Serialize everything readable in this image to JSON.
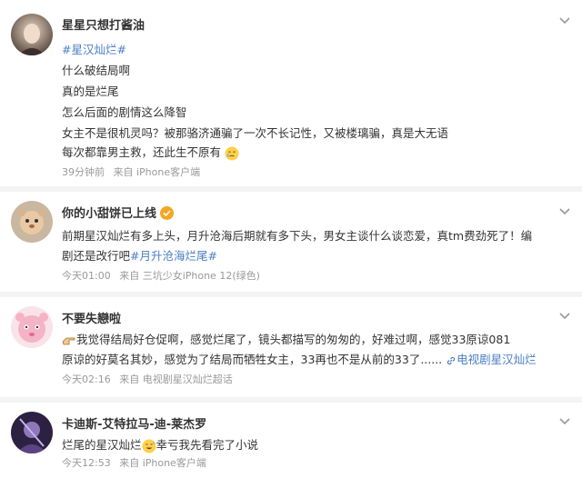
{
  "posts": [
    {
      "username": "星星只想打酱油",
      "lines": [
        "#星汉灿烂#",
        "什么破结局啊",
        "真的是烂尾",
        "怎么后面的剧情这么降智",
        "女主不是很机灵吗？被那骆济通骗了一次不长记性，又被楼璃骗，真是大无语",
        "每次都靠男主救，还此生不原有"
      ],
      "time": "39分钟前",
      "source": "来自 iPhone客户端"
    },
    {
      "username": "你的小甜饼已上线",
      "lines": [
        "前期星汉灿烂有多上头，月升沧海后期就有多下头，男女主谈什么谈恋爱，真tm费劲死了！编",
        "剧还是改行吧",
        "#月升沧海烂尾#"
      ],
      "time": "今天01:00",
      "source": "来自 三坑少女iPhone 12(绿色)"
    },
    {
      "username": "不要失戀啦",
      "lines": [
        "我觉得结局好仓促啊，感觉烂尾了，镜头都描写的匆匆的，好难过啊，感觉33原谅081",
        "原谅的好莫名其妙，感觉为了结局而牺牲女主，33再也不是从前的33了......",
        "电视剧星汉灿烂"
      ],
      "time": "今天02:16",
      "source": "来自 电视剧星汉灿烂超话"
    },
    {
      "username": "卡迪斯-艾特拉马-迪-莱杰罗",
      "lines": [
        "烂尾的星汉灿烂",
        "幸亏我先看完了小说"
      ],
      "time": "今天12:53",
      "source": "来自 iPhone客户端"
    }
  ],
  "icons": {
    "chevron": "chevron-down-icon",
    "verified": "verified-badge-icon",
    "link": "link-icon"
  },
  "colors": {
    "tag": "#4a7ec3",
    "meta": "#999999"
  }
}
